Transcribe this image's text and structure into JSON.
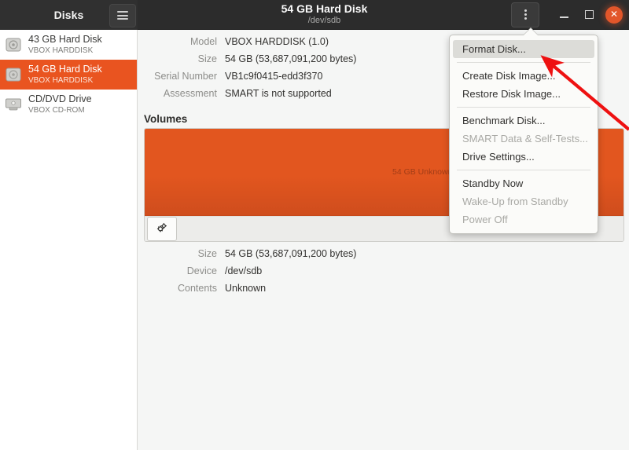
{
  "titlebar": {
    "app_name": "Disks",
    "hamburger_icon": "hamburger-icon",
    "title": "54 GB Hard Disk",
    "subtitle": "/dev/sdb",
    "kebab_icon": "kebab-menu-icon",
    "minimize_label": "Minimize",
    "maximize_label": "Maximize",
    "close_label": "Close"
  },
  "sidebar": {
    "items": [
      {
        "name": "43 GB Hard Disk",
        "model": "VBOX HARDDISK",
        "icon": "hard-disk-icon",
        "selected": false
      },
      {
        "name": "54 GB Hard Disk",
        "model": "VBOX HARDDISK",
        "icon": "hard-disk-icon",
        "selected": true
      },
      {
        "name": "CD/DVD Drive",
        "model": "VBOX CD-ROM",
        "icon": "optical-drive-icon",
        "selected": false
      }
    ]
  },
  "drive_info": {
    "rows": [
      {
        "key": "Model",
        "value": "VBOX HARDDISK (1.0)"
      },
      {
        "key": "Size",
        "value": "54 GB (53,687,091,200 bytes)"
      },
      {
        "key": "Serial Number",
        "value": "VB1c9f0415-edd3f370"
      },
      {
        "key": "Assessment",
        "value": "SMART is not supported"
      }
    ]
  },
  "volumes": {
    "section_title": "Volumes",
    "bar_label": "54 GB Unknown",
    "bar_color": "#e2561f",
    "gear_icon": "gear-icon",
    "details": [
      {
        "key": "Size",
        "value": "54 GB (53,687,091,200 bytes)"
      },
      {
        "key": "Device",
        "value": "/dev/sdb"
      },
      {
        "key": "Contents",
        "value": "Unknown"
      }
    ]
  },
  "menu": {
    "items": [
      {
        "label": "Format Disk...",
        "disabled": false,
        "highlighted": true,
        "sep_after": true
      },
      {
        "label": "Create Disk Image...",
        "disabled": false,
        "highlighted": false,
        "sep_after": false
      },
      {
        "label": "Restore Disk Image...",
        "disabled": false,
        "highlighted": false,
        "sep_after": true
      },
      {
        "label": "Benchmark Disk...",
        "disabled": false,
        "highlighted": false,
        "sep_after": false
      },
      {
        "label": "SMART Data & Self-Tests...",
        "disabled": true,
        "highlighted": false,
        "sep_after": false
      },
      {
        "label": "Drive Settings...",
        "disabled": false,
        "highlighted": false,
        "sep_after": true
      },
      {
        "label": "Standby Now",
        "disabled": false,
        "highlighted": false,
        "sep_after": false
      },
      {
        "label": "Wake-Up from Standby",
        "disabled": true,
        "highlighted": false,
        "sep_after": false
      },
      {
        "label": "Power Off",
        "disabled": true,
        "highlighted": false,
        "sep_after": false
      }
    ]
  },
  "annotation": {
    "arrow_color": "#ee1111",
    "points_to": "Format Disk..."
  },
  "theme": {
    "accent": "#e95420",
    "titlebar_bg": "#2c2c2c",
    "main_bg": "#f5f6f5",
    "sidebar_bg": "#ffffff"
  }
}
